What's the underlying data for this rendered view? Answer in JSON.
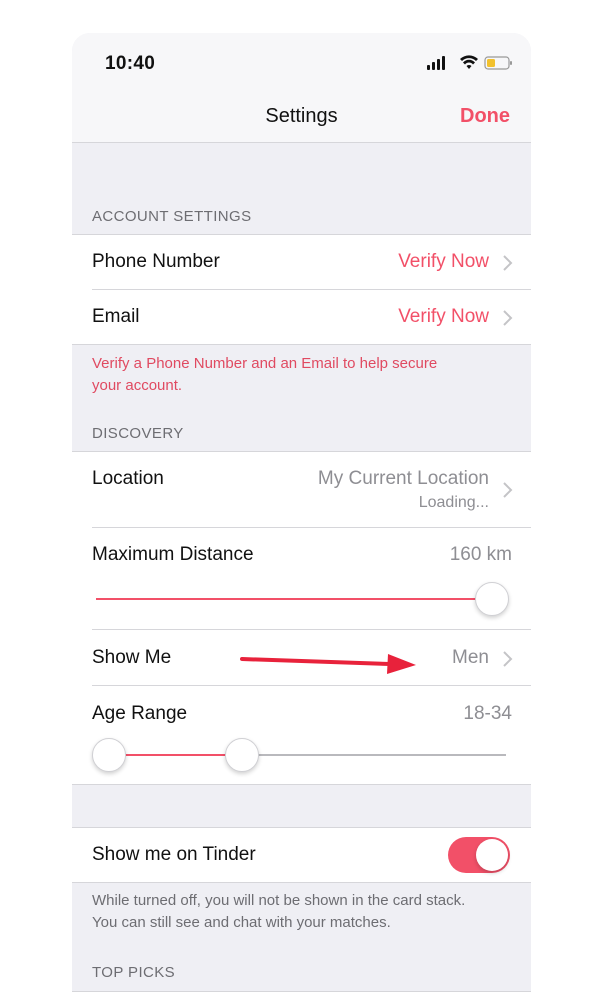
{
  "status_bar": {
    "time": "10:40",
    "icons": [
      "signal-icon",
      "wifi-icon",
      "battery-icon"
    ]
  },
  "navbar": {
    "title": "Settings",
    "done_label": "Done"
  },
  "colors": {
    "accent": "#f25068",
    "secondary_text": "#8e8e93",
    "background": "#efeff4"
  },
  "account_settings": {
    "header": "ACCOUNT SETTINGS",
    "rows": [
      {
        "label": "Phone Number",
        "value": "Verify Now"
      },
      {
        "label": "Email",
        "value": "Verify Now"
      }
    ],
    "note_line1": "Verify a Phone Number and an Email to help secure",
    "note_line2": "your account."
  },
  "discovery": {
    "header": "DISCOVERY",
    "location": {
      "label": "Location",
      "value": "My Current Location",
      "subvalue": "Loading..."
    },
    "max_distance": {
      "label": "Maximum Distance",
      "value": "160 km",
      "slider_fraction": 1.0
    },
    "show_me": {
      "label": "Show Me",
      "value": "Men"
    },
    "age_range": {
      "label": "Age Range",
      "value": "18-34",
      "low_fraction": 0.0,
      "high_fraction": 0.33
    }
  },
  "show_on_tinder": {
    "label": "Show me on Tinder",
    "enabled": true,
    "note_line1": "While turned off, you will not be shown in the card stack.",
    "note_line2": "You can still see and chat with your matches."
  },
  "top_picks": {
    "header": "TOP PICKS"
  }
}
